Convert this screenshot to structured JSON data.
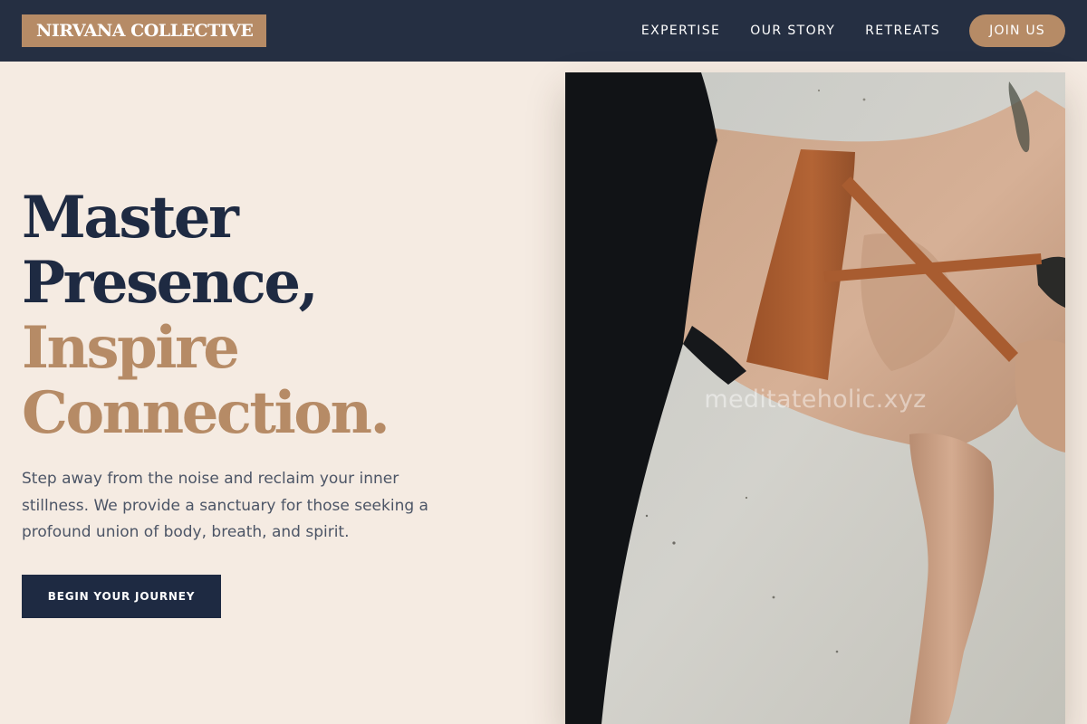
{
  "brand": {
    "name": "NIRVANA COLLECTIVE"
  },
  "nav": {
    "links": [
      "EXPERTISE",
      "OUR STORY",
      "RETREATS"
    ],
    "cta_label": "JOIN US"
  },
  "hero": {
    "title_lines": [
      "Master",
      "Presence,",
      "Inspire",
      "Connection."
    ],
    "description": "Step away from the noise and reclaim your inner stillness. We provide a sanctuary for those seeking a profound union of body, breath, and spirit.",
    "cta_label": "BEGIN YOUR JOURNEY"
  },
  "image": {
    "watermark": "meditateholic.xyz"
  },
  "colors": {
    "navbar": "#252f42",
    "accent": "#b68b66",
    "dark_text": "#1e2a42",
    "background": "#f5ebe2",
    "body_text": "#4c5566"
  }
}
